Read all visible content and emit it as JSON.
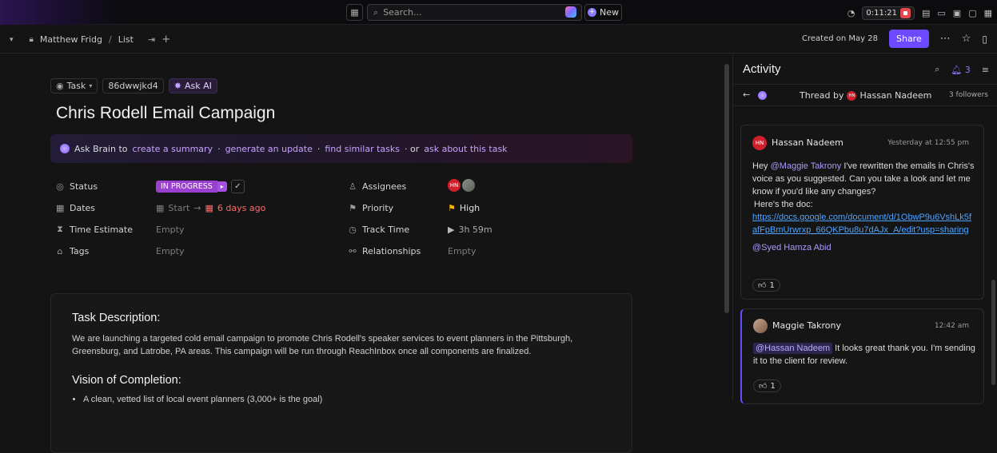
{
  "topbar": {
    "search_placeholder": "Search...",
    "new_label": "New",
    "timer": "0:11:21"
  },
  "breadcrumb": {
    "space": "Matthew Fridg",
    "separator": "/",
    "list": "List"
  },
  "header_right": {
    "created": "Created on May 28",
    "share_label": "Share"
  },
  "task": {
    "type_label": "Task",
    "id": "86dwwjkd4",
    "ask_ai_label": "Ask AI",
    "title": "Chris Rodell Email Campaign"
  },
  "brain": {
    "prefix": "Ask Brain to",
    "opt1": "create a summary",
    "sep1": "·",
    "opt2": "generate an update",
    "sep2": "·",
    "opt3": "find similar tasks",
    "sep3": "· or",
    "opt4": "ask about this task"
  },
  "fields": {
    "status_label": "Status",
    "status_value": "IN PROGRESS",
    "dates_label": "Dates",
    "dates_start": "Start",
    "dates_due": "6 days ago",
    "estimate_label": "Time Estimate",
    "estimate_value": "Empty",
    "tags_label": "Tags",
    "tags_value": "Empty",
    "assignees_label": "Assignees",
    "assignee_initials": "HN",
    "priority_label": "Priority",
    "priority_value": "High",
    "track_label": "Track Time",
    "track_value": "3h 59m",
    "relationships_label": "Relationships",
    "relationships_value": "Empty"
  },
  "description": {
    "heading": "Task Description:",
    "text": "We are launching a targeted cold email campaign to promote Chris Rodell's speaker services to event planners in the Pittsburgh, Greensburg, and Latrobe, PA areas. This campaign will be run through ReachInbox once all components are finalized.",
    "heading2": "Vision of Completion:",
    "bullet1": "A clean, vetted list of local event planners (3,000+ is the goal)"
  },
  "activity": {
    "title": "Activity",
    "notif_count": "3",
    "thread_prefix": "Thread by",
    "thread_author": "Hassan Nadeem",
    "followers": "3 followers",
    "comments": [
      {
        "author": "Hassan Nadeem",
        "initials": "HN",
        "time": "Yesterday at 12:55 pm",
        "greet": "Hey",
        "mention": "@Maggie Takrony",
        "text": " I've rewritten the emails in Chris's voice as you suggested. Can you take a look and let me know if you'd like any changes?",
        "doc_intro": "Here's the doc:",
        "link": "https://docs.google.com/document/d/1ObwP9u6VshLk5fafFpBmUrwrxp_66QKPbu8u7dAJx_A/edit?usp=sharing",
        "mention2": "@Syed Hamza Abid",
        "reaction": "1"
      },
      {
        "author": "Maggie Takrony",
        "time": "12:42 am",
        "mention": "@Hassan Nadeem",
        "text": " It looks great thank you. I'm sending it to the client for review.",
        "reaction": "1"
      }
    ]
  }
}
